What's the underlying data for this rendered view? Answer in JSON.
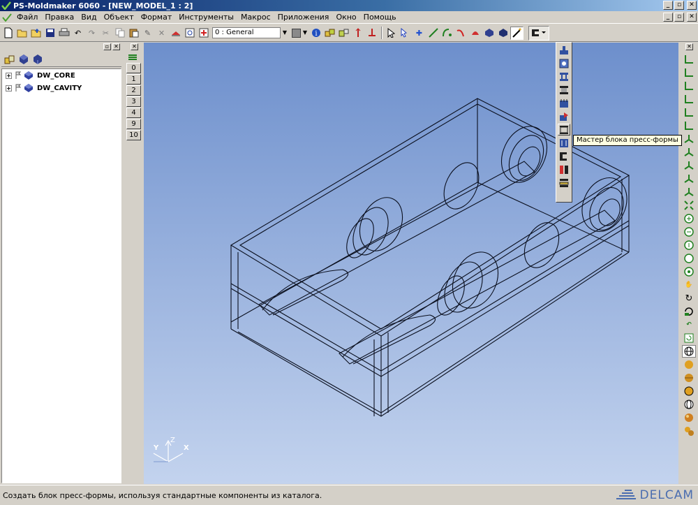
{
  "window": {
    "title": "PS-Moldmaker 6060 - [NEW_MODEL_1 : 2]"
  },
  "menu": {
    "items": [
      "Файл",
      "Правка",
      "Вид",
      "Объект",
      "Формат",
      "Инструменты",
      "Макрос",
      "Приложения",
      "Окно",
      "Помощь"
    ]
  },
  "toolbar": {
    "layer_value": "0   : General"
  },
  "tree": {
    "items": [
      {
        "label": "DW_CORE",
        "expander": "+"
      },
      {
        "label": "DW_CAVITY",
        "expander": "+"
      }
    ]
  },
  "levels": {
    "buttons": [
      "0",
      "1",
      "2",
      "3",
      "4",
      "9",
      "10"
    ]
  },
  "tooltip": {
    "text": "Мастер блока пресс-формы"
  },
  "axes": {
    "z": "Z",
    "y": "Y",
    "x": "X"
  },
  "status": {
    "text": "Создать блок пресс-формы, используя стандартные компоненты из каталога.",
    "brand": "DELCAM"
  },
  "colors": {
    "titlebar_start": "#0a246a",
    "viewport_top": "#6d8fcc",
    "viewport_bottom": "#c3d3ee",
    "tooltip_bg": "#ffffe1",
    "brand": "#4a6db0"
  }
}
